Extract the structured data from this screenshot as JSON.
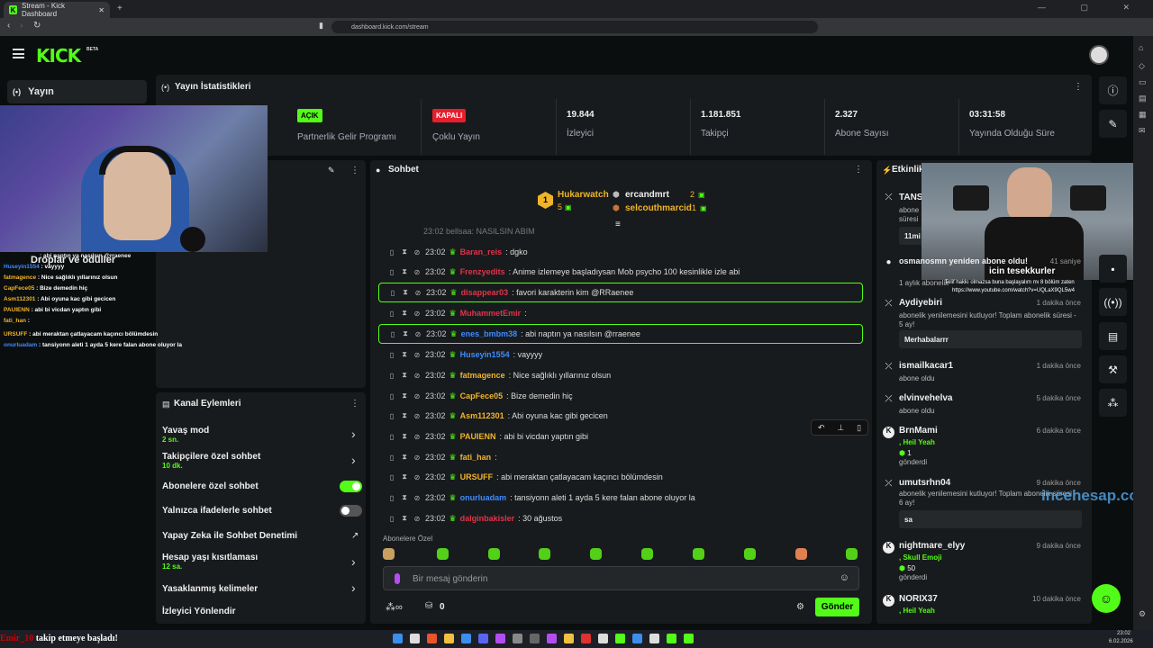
{
  "browser": {
    "tab_title": "Stream - Kick Dashboard",
    "url": "dashboard.kick.com/stream",
    "win_controls": "—  ▢  ✕"
  },
  "header": {
    "logo": "KICK",
    "beta": "BETA"
  },
  "nav": {
    "yayin": "Yayın"
  },
  "stats": {
    "title": "Yayın İstatistikleri",
    "partner_badge": "AÇIK",
    "partner_label": "Partnerlik Gelir Programı",
    "multi_badge": "KAPALI",
    "multi_label": "Çoklu Yayın",
    "viewers_num": "19.844",
    "viewers_label": "İzleyici",
    "followers_num": "1.181.851",
    "followers_label": "Takipçi",
    "subs_num": "2.327",
    "subs_label": "Abone Sayısı",
    "uptime_num": "03:31:58",
    "uptime_label": "Yayında Olduğu Süre"
  },
  "chat": {
    "title": "Sohbet",
    "top": [
      {
        "name": "Hukarwatch",
        "count": "5"
      },
      {
        "name": "ercandmrt",
        "count": "2"
      },
      {
        "name": "selcouthmarcid",
        "count": "1"
      }
    ],
    "cut_msg": "23:02 bellsaa: NASILSIN ABIM",
    "messages": [
      {
        "time": "23:02",
        "user": "Baran_reis",
        "color": "#e0334a",
        "text": ": dgko"
      },
      {
        "time": "23:02",
        "user": "Frenzyedits",
        "color": "#e0334a",
        "text": ": Anime izlemeye başladıysan Mob psycho 100 kesinlikle izle abi"
      },
      {
        "time": "23:02",
        "user": "disappear03",
        "color": "#e0334a",
        "text": ": favori karakterin kim @RRaenee"
      },
      {
        "time": "23:02",
        "user": "MuhammetEmir",
        "color": "#e0334a",
        "text": ":"
      },
      {
        "time": "23:02",
        "user": "enes_bmbm38",
        "color": "#3d8bff",
        "text": ": abi naptın ya nasılsın @rraenee"
      },
      {
        "time": "23:02",
        "user": "Huseyin1554",
        "color": "#3d8bff",
        "text": ": vayyyy"
      },
      {
        "time": "23:02",
        "user": "fatmagence",
        "color": "#f0b429",
        "text": ": Nice sağlıklı yıllarınız olsun"
      },
      {
        "time": "23:02",
        "user": "CapFece05",
        "color": "#f0b429",
        "text": ": Bize demedin hiç"
      },
      {
        "time": "23:02",
        "user": "Asm112301",
        "color": "#f0b429",
        "text": ": Abi oyuna kac gibi gecicen"
      },
      {
        "time": "23:02",
        "user": "PAUIENN",
        "color": "#f0b429",
        "text": ": abi bi vicdan yaptın gibi"
      },
      {
        "time": "23:02",
        "user": "fati_han",
        "color": "#f0b429",
        "text": ":"
      },
      {
        "time": "23:02",
        "user": "URSUFF",
        "color": "#f0b429",
        "text": ": abi meraktan çatlayacam kaçıncı bölümdesin"
      },
      {
        "time": "23:02",
        "user": "onurluadam",
        "color": "#3d8bff",
        "text": ": tansiyonn aleti 1 ayda 5 kere falan abone oluyor la"
      },
      {
        "time": "23:02",
        "user": "dalginbakisler",
        "color": "#e0334a",
        "text": ": 30 ağustos"
      }
    ],
    "emote_label": "Abonelere Özel",
    "input_placeholder": "Bir mesaj gönderin",
    "points": "0",
    "send": "Gönder"
  },
  "left_panel": {
    "overlay_title": "Droplar ve ödüller",
    "overlay_lines": [
      {
        "user": "rraenee",
        "text": ": abi naptın ya nasılsın @rraenee",
        "color": "#3d8bff"
      },
      {
        "user": "Huseyin1554",
        "text": " : vayyyy",
        "color": "#3d8bff"
      },
      {
        "user": "fatmagence",
        "text": " : Nice sağlıklı yıllarınız olsun",
        "color": "#f0b429"
      },
      {
        "user": "CapFece05",
        "text": " : Bize demedin hiç",
        "color": "#f0b429"
      },
      {
        "user": "Asm112301",
        "text": " : Abi oyuna kac gibi gecicen",
        "color": "#f0b429"
      },
      {
        "user": "PAUIENN",
        "text": " : abi bi vicdan yaptın gibi",
        "color": "#f0b429"
      },
      {
        "user": "fati_han",
        "text": " :",
        "color": "#f0b429"
      },
      {
        "user": "URSUFF",
        "text": " : abi meraktan çatlayacam kaçıncı bölümdesin",
        "color": "#f0b429"
      },
      {
        "user": "onurluadam",
        "text": " : tansiyonn aleti 1 ayda 5 kere falan abone oluyor la",
        "color": "#3d8bff"
      }
    ],
    "follow_toast": "takip etmeye başladı!"
  },
  "actions": {
    "title": "Kanal Eylemleri",
    "slow": "Yavaş mod",
    "slow_sub": "2 sn.",
    "follower": "Takipçilere özel sohbet",
    "follower_sub": "10 dk.",
    "subs_only": "Abonelere özel sohbet",
    "emotes_only": "Yalnızca ifadelerle sohbet",
    "ai": "Yapay Zeka ile Sohbet Denetimi",
    "age": "Hesap yaşı kısıtlaması",
    "age_sub": "12 sa.",
    "banned": "Yasaklanmış kelimeler",
    "redirect": "İzleyici Yönlendir"
  },
  "activity": {
    "title": "Etkinlikler",
    "items": [
      {
        "name": "TANS",
        "time": "",
        "sub": "abone",
        "sub2": "süresi",
        "box": "11mi"
      },
      {
        "name": "osmanosmn yeniden abone oldu!",
        "time": "41 saniye",
        "sub": "1 aylık abonelik"
      },
      {
        "name": "Aydiyebiri",
        "time": "1 dakika önce",
        "sub": "abonelik yenilemesini kutluyor! Toplam abonelik süresi - 5 ay!",
        "box": "Merhabalarrr"
      },
      {
        "name": "ismailkacar1",
        "time": "1 dakika önce",
        "sub": "abone oldu"
      },
      {
        "name": "elvinvehelva",
        "time": "5 dakika önce",
        "sub": "abone oldu"
      },
      {
        "name": "BrnMami",
        "time": "6 dakika önce",
        "reward": ", Heil Yeah",
        "amount": "1",
        "sent": "gönderdi"
      },
      {
        "name": "umutsrhn04",
        "time": "9 dakika önce",
        "sub": "abonelik yenilemesini kutluyor! Toplam abonelik süresi - 6 ay!",
        "box": "sa"
      },
      {
        "name": "nightmare_elyy",
        "time": "9 dakika önce",
        "reward": ", Skull Emoji",
        "amount": "50",
        "sent": "gönderdi"
      },
      {
        "name": "NORIX37",
        "time": "10 dakika önce",
        "reward": ", Heil Yeah"
      }
    ],
    "cam_caption": "icin tesekkurler",
    "cam_url": "Telif hakkı olmazsa buna başlayalım mı 8 bölüm zaten",
    "cam_url2": "https://www.youtube.com/watch?v=UQLaX9QL5w4",
    "watermark": "incehesap.com"
  },
  "taskbar": {
    "clock": "23:02",
    "date": "6.02.2026"
  }
}
